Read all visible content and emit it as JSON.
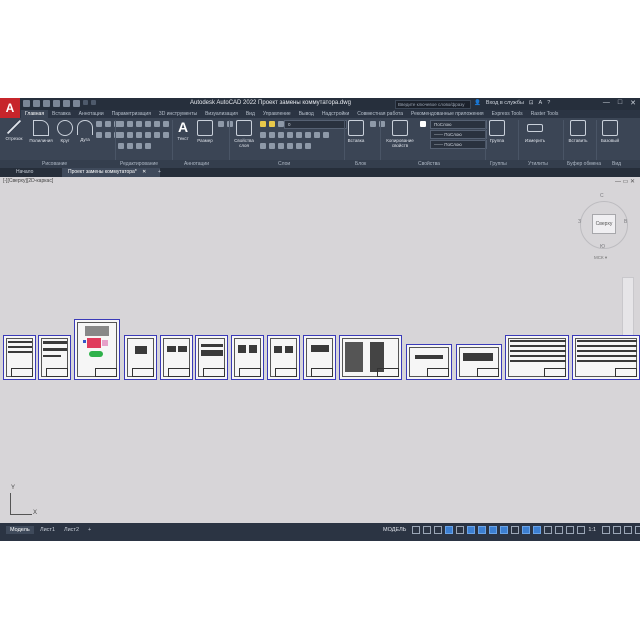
{
  "title_bar": {
    "logo": "A",
    "title": "Autodesk AutoCAD 2022   Проект замены коммутатора.dwg",
    "search_placeholder": "Введите ключевое слово/фразу",
    "user": "Вход в службы",
    "win_controls": [
      "—",
      "□",
      "✕"
    ]
  },
  "ribbon": {
    "tabs": [
      "Главная",
      "Вставка",
      "Аннотации",
      "Параметризация",
      "3D инструменты",
      "Визуализация",
      "Вид",
      "Управление",
      "Вывод",
      "Надстройки",
      "Совместная работа",
      "Рекомендованные приложения",
      "Express Tools",
      "Raster Tools"
    ],
    "active_tab": "Главная",
    "tools": {
      "line": "Отрезок",
      "polyline": "Полилиния",
      "circle": "Круг",
      "arc": "Дуга",
      "text": "Текст",
      "dimension": "Размер",
      "layer_props": "Свойства слоя",
      "insert": "Вставка",
      "match_props": "Копирование свойств",
      "group": "Группа",
      "measure": "Измерить",
      "paste": "Вставить",
      "base": "Базовый"
    },
    "dropdowns": {
      "layer": "0",
      "color": "ПоСлою",
      "linetype": "—— ПоСлою",
      "lineweight": "—— ПоСлою"
    },
    "panels": [
      "Рисование",
      "Редактирование",
      "Аннотации",
      "Слои",
      "Блок",
      "Свойства",
      "Группы",
      "Утилиты",
      "Буфер обмена",
      "Вид"
    ]
  },
  "file_tabs": {
    "start": "Начало",
    "active": "Проект замены коммутатора*",
    "add": "+"
  },
  "canvas": {
    "viewport_label": "[-][Сверху][2D-каркас]",
    "controls": "—  ▭  ✕",
    "viewcube": {
      "face": "Сверху",
      "n": "С",
      "s": "Ю",
      "w": "З",
      "e": "В",
      "wcs": "МСК ▾"
    }
  },
  "ucs": {
    "x": "X",
    "y": "Y"
  },
  "status_bar": {
    "tabs": [
      "Модель",
      "Лист1",
      "Лист2"
    ],
    "add": "+",
    "model_label": "МОДЕЛЬ",
    "scale": "1:1"
  },
  "colors": {
    "app_bg": "#2b3443",
    "canvas_bg": "#d7d5d8",
    "sheet_border": "#3a3ab8",
    "logo_red": "#c7252b"
  }
}
